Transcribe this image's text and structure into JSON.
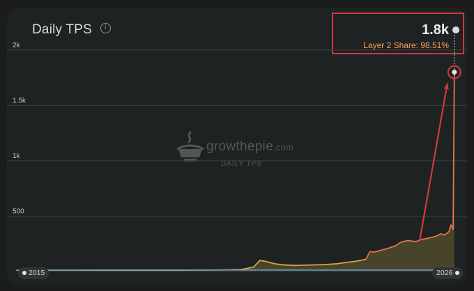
{
  "title": "Daily TPS",
  "info_icon": "info-icon",
  "readout": {
    "value": "1.8k",
    "share": "Layer 2 Share: 98.51%"
  },
  "watermark": {
    "brand": "growthepie",
    "domain": ".com",
    "subtitle": "DAILY TPS",
    "icon": "pie-logo-icon"
  },
  "x_range_labels": {
    "start": "2015",
    "end": "2026"
  },
  "colors": {
    "l2": "#e0744e",
    "l2_fill": "#4f4a2a",
    "mid": "#d9a441",
    "early": "#b9c04a",
    "l1": "#6a93c4",
    "annotation": "#d0393a"
  },
  "chart_data": {
    "type": "area",
    "title": "Daily TPS",
    "xlabel": "",
    "ylabel": "",
    "x_range": [
      2015.6,
      2026.2
    ],
    "ylim": [
      0,
      2200
    ],
    "y_ticks": [
      500,
      1000,
      1500,
      2000
    ],
    "y_tick_labels": [
      "500",
      "1k",
      "1.5k",
      "2k"
    ],
    "grid": true,
    "highlight_value": "1.8k",
    "layer2_share": "98.51%",
    "series": [
      {
        "x": [
          2015.6,
          2017.0,
          2018.5,
          2019.5,
          2020.5,
          2021.0,
          2021.3,
          2021.45,
          2021.6,
          2021.8,
          2022.0,
          2022.3,
          2022.6,
          2023.0,
          2023.3,
          2023.5,
          2023.8,
          2024.0,
          2024.1,
          2024.2,
          2024.35,
          2024.5,
          2024.7,
          2024.85,
          2025.0,
          2025.2,
          2025.35,
          2025.5,
          2025.7,
          2025.8,
          2025.9,
          2026.0,
          2026.05,
          2026.1,
          2026.13
        ],
        "values": [
          12,
          12,
          12,
          12,
          14,
          18,
          40,
          100,
          90,
          70,
          60,
          55,
          58,
          62,
          70,
          80,
          95,
          110,
          180,
          175,
          190,
          205,
          230,
          265,
          280,
          270,
          290,
          300,
          320,
          340,
          330,
          360,
          420,
          380,
          1800
        ]
      },
      {
        "x": [
          2015.6,
          2017.0,
          2019.0,
          2021.0,
          2023.0,
          2025.0,
          2026.13
        ],
        "values": [
          12,
          13,
          14,
          14,
          13,
          13,
          14
        ]
      }
    ]
  }
}
